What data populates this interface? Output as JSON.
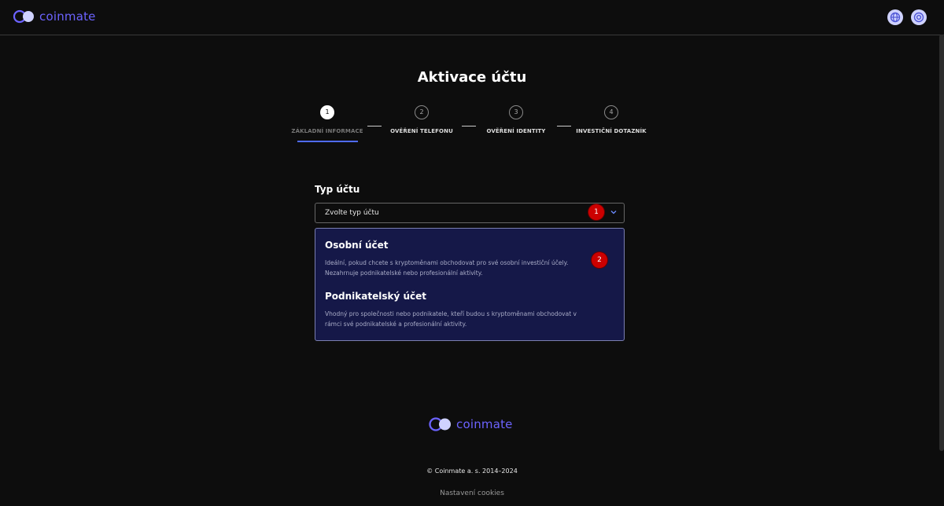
{
  "header": {
    "brand": "coinmate",
    "brand_color": "#6c63ff",
    "icons": [
      "globe-icon",
      "support-icon"
    ]
  },
  "page": {
    "title": "Aktivace účtu"
  },
  "stepper": {
    "active_index": 0,
    "steps": [
      {
        "number": "1",
        "label": "ZÁKLADNÍ INFORMACE"
      },
      {
        "number": "2",
        "label": "OVĚŘENÍ TELEFONU"
      },
      {
        "number": "3",
        "label": "OVĚŘENÍ IDENTITY"
      },
      {
        "number": "4",
        "label": "INVESTIČNÍ DOTAZNÍK"
      }
    ]
  },
  "form": {
    "account_type_label": "Typ účtu",
    "select_placeholder": "Zvolte typ účtu",
    "options": [
      {
        "title": "Osobní účet",
        "description_line1": "Ideální, pokud chcete s kryptoměnami obchodovat pro své osobní investiční účely.",
        "description_line2": "Nezahrnuje podnikatelské nebo profesionální aktivity."
      },
      {
        "title": "Podnikatelský účet",
        "description_line1": "Vhodný pro společnosti nebo podnikatele, kteří budou s kryptoměnami obchodovat v",
        "description_line2": "rámci své podnikatelské a profesionální aktivity."
      }
    ]
  },
  "markers": [
    "1",
    "2"
  ],
  "footer": {
    "brand": "coinmate",
    "copyright": "© Coinmate a. s. 2014–2024",
    "cookies": "Nastavení cookies"
  },
  "colors": {
    "background": "#0d0d0d",
    "accent": "#4f6bff",
    "dropdown_bg": "#151848",
    "marker": "#cc0000"
  }
}
